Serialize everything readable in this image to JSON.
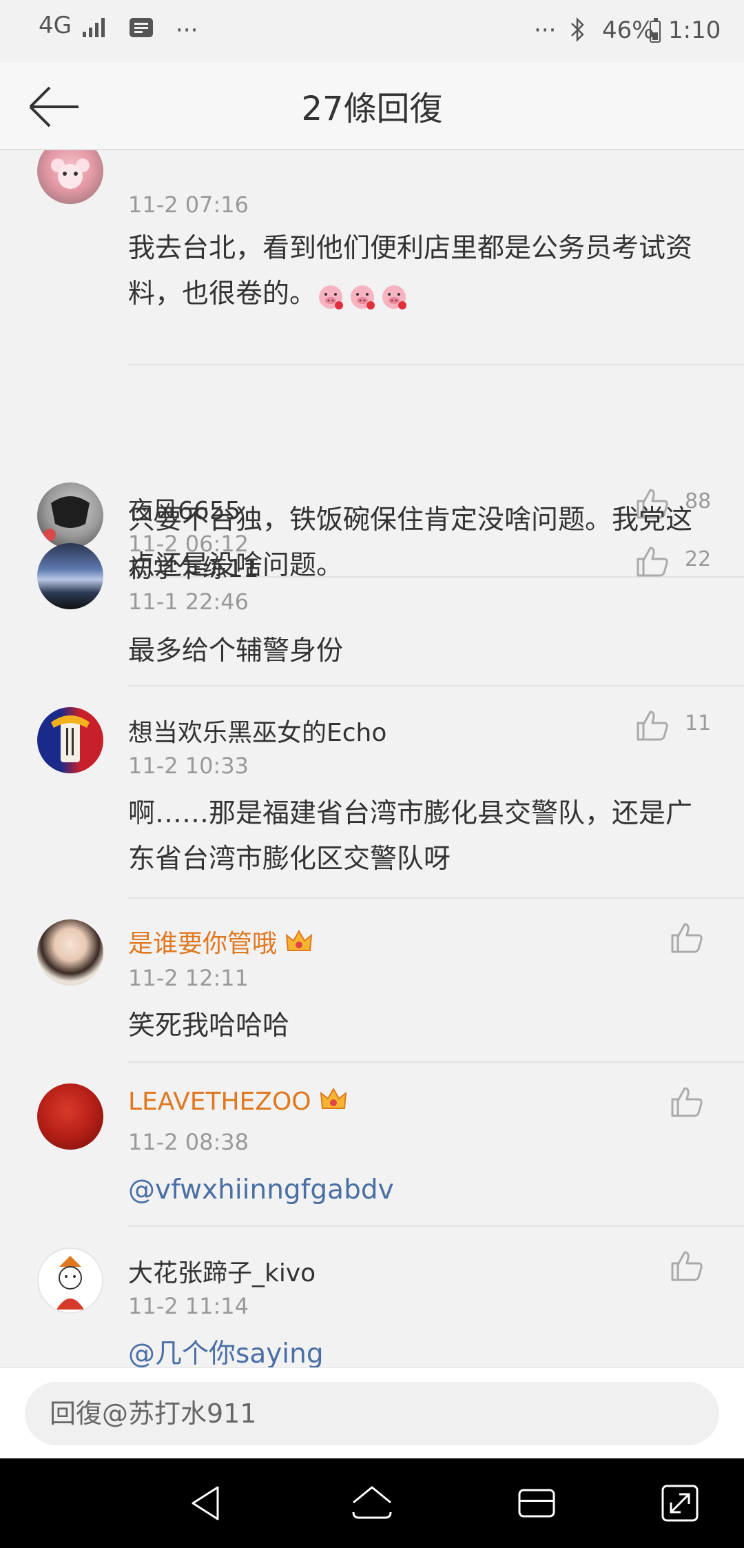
{
  "status_bar": {
    "network": "4G",
    "signal_icon": "signal-bars-icon",
    "message_icon": "message-icon",
    "dots_left": "···",
    "dots_right": "···",
    "bluetooth_icon": "bluetooth-icon",
    "battery": "46%",
    "battery_level": 0.46,
    "time": "1:10"
  },
  "header": {
    "back_icon": "back-arrow-icon",
    "title": "27條回復"
  },
  "comments": [
    {
      "author": "",
      "time": "11-2 07:16",
      "text": "我去台北，看到他们便利店里都是公务员考试资料，也很卷的。",
      "emojis": [
        "pig-emoji",
        "pig-emoji",
        "pig-emoji"
      ],
      "likes": ""
    },
    {
      "author": "夜风6655",
      "time": "11-2 06:12",
      "text": "只要不台独，铁饭碗保住肯定没啥问题。我党这点还是没啥问题。",
      "likes": "88"
    },
    {
      "author": "初学乍练11",
      "time": "11-1 22:46",
      "text": "最多给个辅警身份",
      "likes": "22"
    },
    {
      "author": "想当欢乐黑巫女的Echo",
      "time": "11-2 10:33",
      "text": "啊……那是福建省台湾市膨化县交警队，还是广东省台湾市膨化区交警队呀",
      "likes": "11"
    },
    {
      "author": "是谁要你管哦",
      "time": "11-2 12:11",
      "text": "笑死我哈哈哈",
      "likes": "",
      "vip": true
    },
    {
      "author": "LEAVETHEZOO",
      "time": "11-2 08:38",
      "text": "@vfwxhiinngfgabdv",
      "likes": "",
      "vip": true
    },
    {
      "author": "大花张蹄子_kivo",
      "time": "11-2 11:14",
      "text": "@几个你saying",
      "likes": ""
    }
  ],
  "reply": {
    "placeholder": "回復@苏打水911"
  },
  "nav": {
    "back_icon": "nav-back-icon",
    "home_icon": "nav-home-icon",
    "recent_icon": "nav-recents-icon",
    "expand_icon": "nav-expand-icon"
  },
  "colors": {
    "vip_name": "#e07820",
    "mention": "#4a6fa5",
    "meta": "#999999"
  }
}
